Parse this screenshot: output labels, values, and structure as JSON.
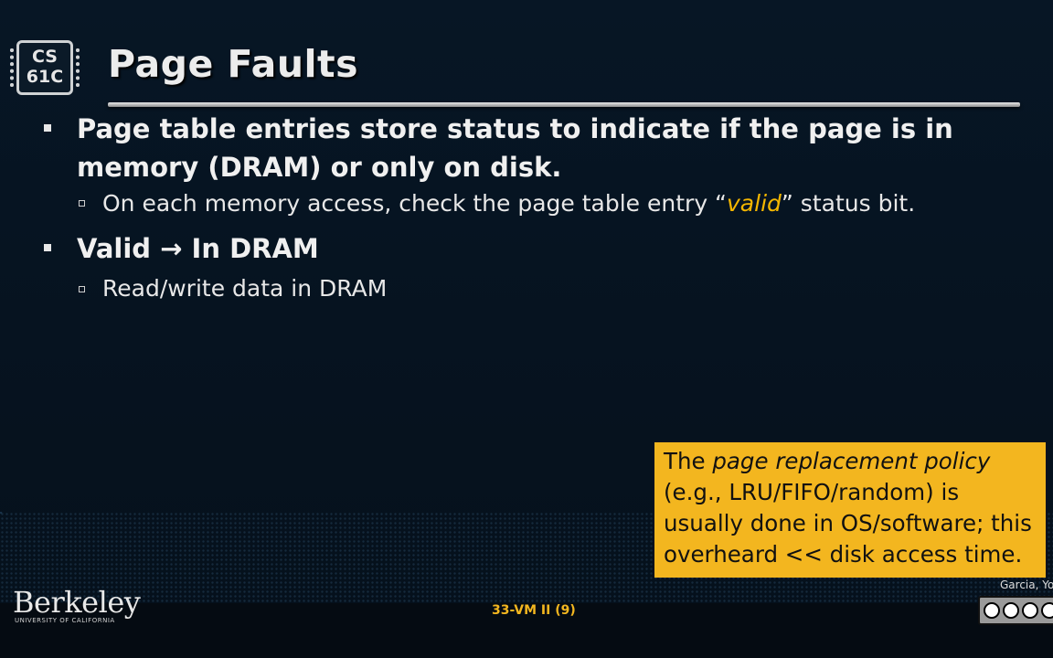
{
  "logo": {
    "text": "CS\n61C"
  },
  "title": "Page Faults",
  "bullets": [
    {
      "text": "Page table entries store status to indicate if the page is in memory (DRAM) or only on disk."
    },
    {
      "text": "Valid → In DRAM"
    }
  ],
  "subbullets": {
    "check": {
      "before": "On each memory access, check the page table entry “",
      "highlight": "valid",
      "after": "” status bit."
    },
    "readwrite": {
      "text": "Read/write data in DRAM"
    }
  },
  "callout": {
    "line1_prefix": "The ",
    "line1_em": "page replacement policy",
    "rest": "(e.g., LRU/FIFO/random) is usually done in OS/software; this overheard << disk access time."
  },
  "footer": {
    "institution": "Berkeley",
    "institution_sub": "UNIVERSITY OF CALIFORNIA",
    "slide_label": "33-VM II (9)",
    "author": "Garcia, Yo",
    "license_icons": [
      "cc",
      "by",
      "nc",
      "sa"
    ]
  },
  "colors": {
    "accent": "#f3b61f",
    "background": "#06121f",
    "highlight": "#f5b700"
  }
}
